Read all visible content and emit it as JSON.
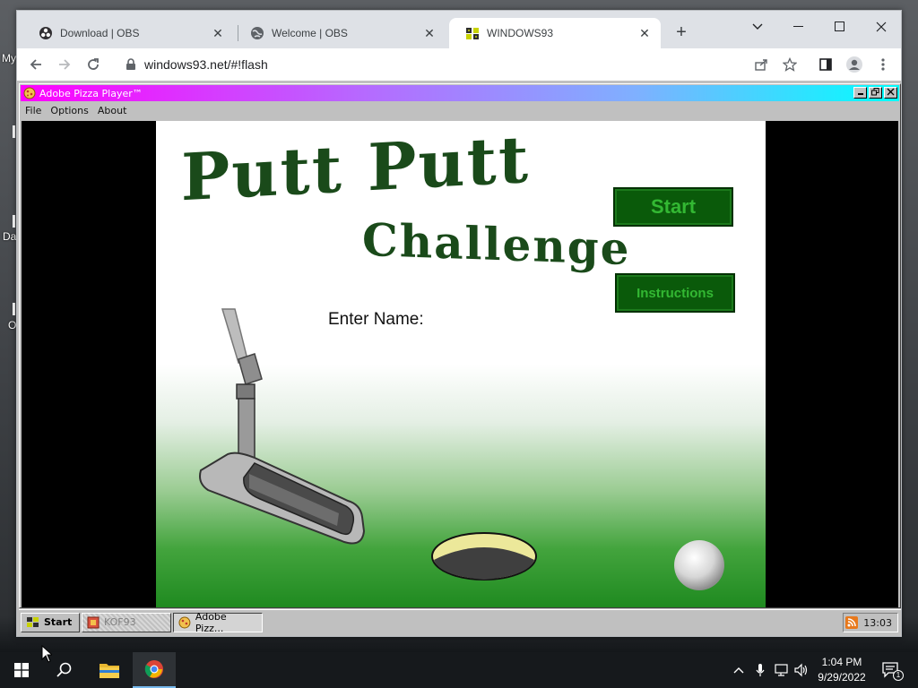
{
  "desktop": {
    "labels": [
      "My",
      "Da",
      "O"
    ]
  },
  "browser": {
    "tabs": [
      {
        "title": "Download | OBS",
        "icon": "obs-icon"
      },
      {
        "title": "Welcome | OBS",
        "icon": "globe-icon"
      },
      {
        "title": "WINDOWS93",
        "icon": "windows93-icon"
      }
    ],
    "active_tab": 2,
    "url": "windows93.net/#!flash"
  },
  "app_window": {
    "title": "Adobe Pizza Player™",
    "menu": [
      "File",
      "Options",
      "About"
    ]
  },
  "game": {
    "title_line1": "Putt Putt",
    "title_line2": "Challenge",
    "start_label": "Start",
    "instructions_label": "Instructions",
    "enter_name_label": "Enter Name:"
  },
  "w93_taskbar": {
    "start_label": "Start",
    "items": [
      "KOF93",
      "Adobe Pizz..."
    ],
    "clock": "13:03"
  },
  "win_taskbar": {
    "time": "1:04 PM",
    "date": "9/29/2022",
    "notification_count": "1"
  },
  "colors": {
    "game_green_dark": "#1a4a1a",
    "game_button": "#0a5a0a",
    "w93_title_gradient_start": "#ff00ff",
    "w93_title_gradient_end": "#00ffff"
  }
}
